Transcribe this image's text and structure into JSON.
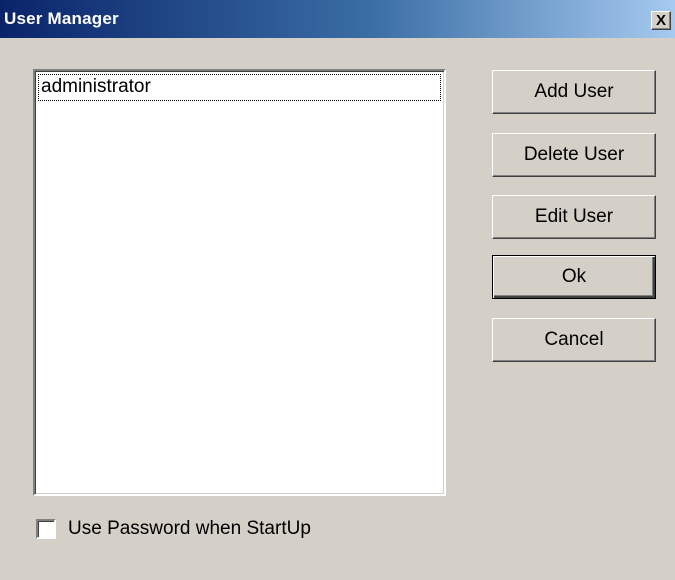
{
  "window": {
    "title": "User Manager",
    "close_glyph": "X"
  },
  "user_list": {
    "items": [
      "administrator"
    ],
    "selected_index": 0
  },
  "buttons": {
    "add_user": "Add User",
    "delete_user": "Delete User",
    "edit_user": "Edit User",
    "ok": "Ok",
    "cancel": "Cancel"
  },
  "options": {
    "use_password_label": "Use Password when StartUp",
    "use_password_checked": false
  }
}
